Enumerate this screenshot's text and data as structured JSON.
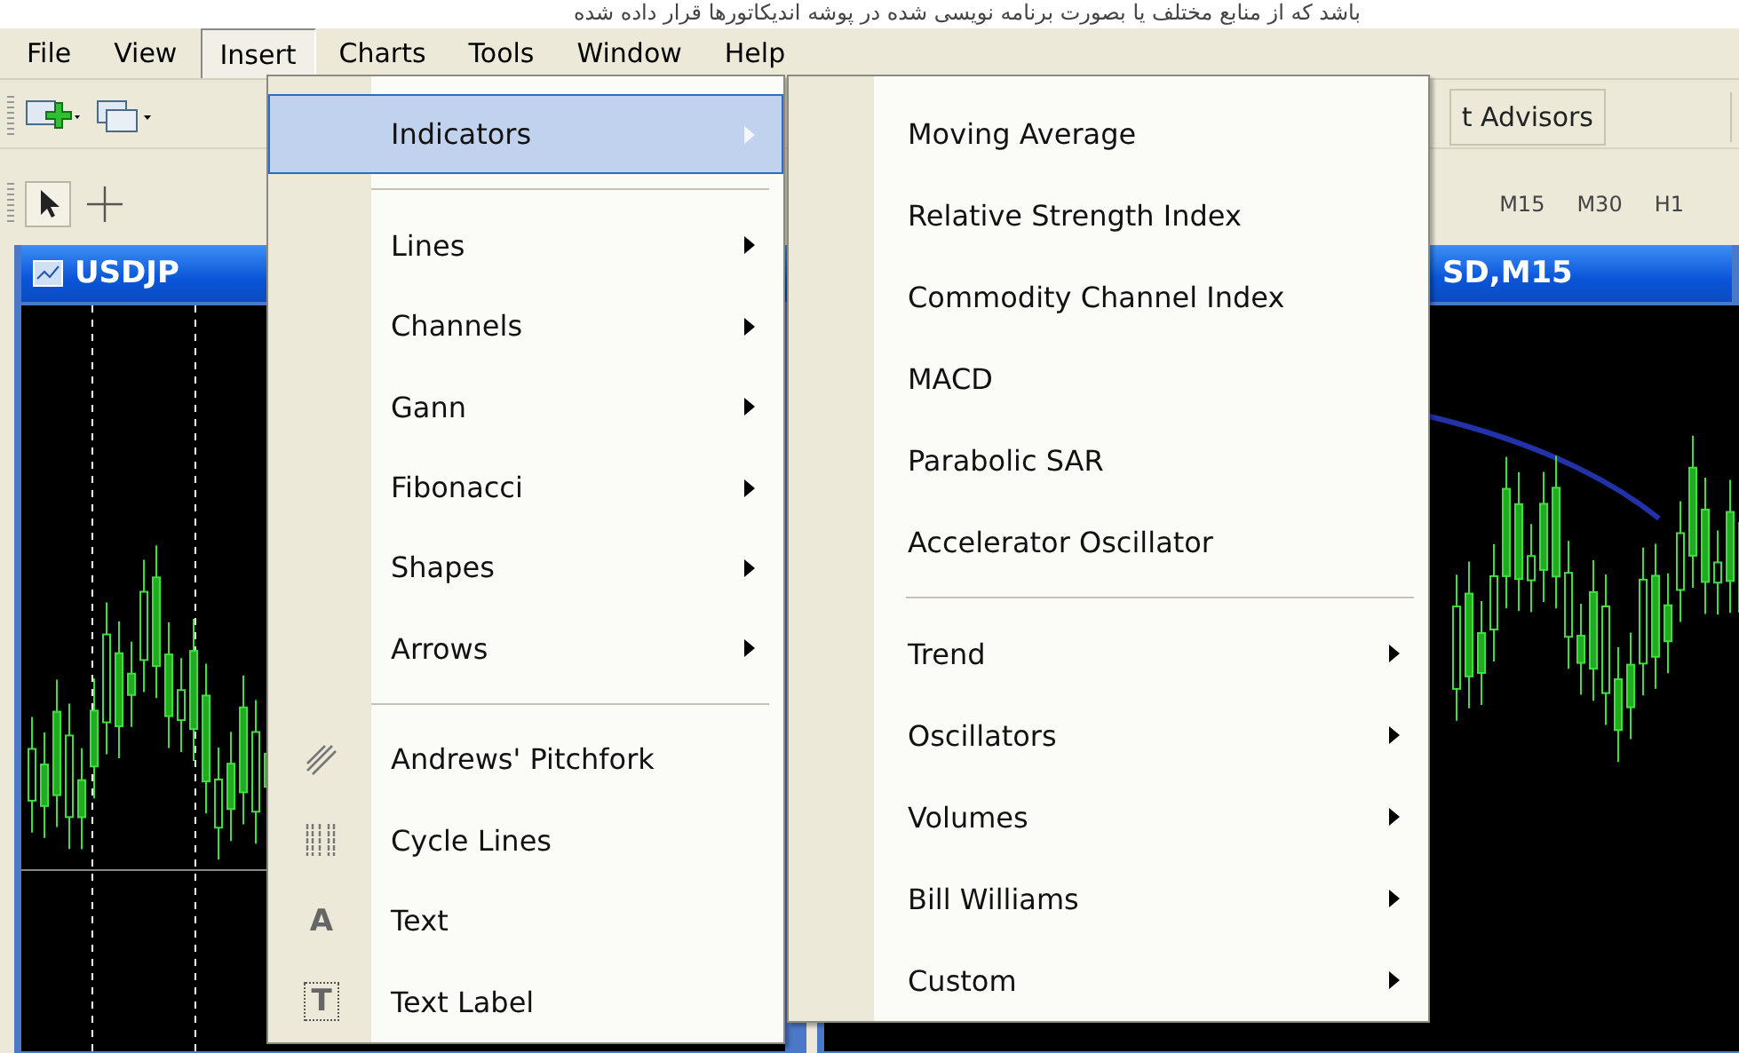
{
  "caption": "باشد که از منابع مختلف یا بصورت برنامه نویسی شده در پوشه اندیکاتورها قرار داده شده",
  "menu_bar": [
    {
      "label": "File",
      "selected": false
    },
    {
      "label": "View",
      "selected": false
    },
    {
      "label": "Insert",
      "selected": true
    },
    {
      "label": "Charts",
      "selected": false
    },
    {
      "label": "Tools",
      "selected": false
    },
    {
      "label": "Window",
      "selected": false
    },
    {
      "label": "Help",
      "selected": false
    }
  ],
  "toolbar": {
    "advisors_button": "t Advisors",
    "timeframes": [
      "M15",
      "M30",
      "H1"
    ]
  },
  "chart_windows": [
    {
      "title": "USDJP"
    },
    {
      "title": "SD,M15"
    }
  ],
  "insert_menu": {
    "items": [
      {
        "kind": "submenu",
        "label": "Indicators",
        "selected": true
      },
      {
        "kind": "separator"
      },
      {
        "kind": "submenu",
        "label": "Lines",
        "selected": false
      },
      {
        "kind": "submenu",
        "label": "Channels",
        "selected": false
      },
      {
        "kind": "submenu",
        "label": "Gann",
        "selected": false
      },
      {
        "kind": "submenu",
        "label": "Fibonacci",
        "selected": false
      },
      {
        "kind": "submenu",
        "label": "Shapes",
        "selected": false
      },
      {
        "kind": "submenu",
        "label": "Arrows",
        "selected": false
      },
      {
        "kind": "separator"
      },
      {
        "kind": "tool",
        "label": "Andrews' Pitchfork",
        "selected": false
      },
      {
        "kind": "tool",
        "label": "Cycle Lines",
        "selected": false
      },
      {
        "kind": "tool",
        "label": "Text",
        "glyph": "A",
        "selected": false
      },
      {
        "kind": "tool",
        "label": "Text Label",
        "glyph": "T",
        "selected": false
      }
    ]
  },
  "indicators_menu": {
    "items": [
      {
        "kind": "item",
        "label": "Moving Average",
        "selected": false
      },
      {
        "kind": "item",
        "label": "Relative Strength Index",
        "selected": false
      },
      {
        "kind": "item",
        "label": "Commodity Channel Index",
        "selected": false
      },
      {
        "kind": "item",
        "label": "MACD",
        "selected": false
      },
      {
        "kind": "item",
        "label": "Parabolic SAR",
        "selected": false
      },
      {
        "kind": "item",
        "label": "Accelerator Oscillator",
        "selected": false
      },
      {
        "kind": "separator"
      },
      {
        "kind": "submenu",
        "label": "Trend",
        "selected": false
      },
      {
        "kind": "submenu",
        "label": "Oscillators",
        "selected": false
      },
      {
        "kind": "submenu",
        "label": "Volumes",
        "selected": false
      },
      {
        "kind": "submenu",
        "label": "Bill Williams",
        "selected": false
      },
      {
        "kind": "submenu",
        "label": "Custom",
        "selected": false
      }
    ]
  }
}
